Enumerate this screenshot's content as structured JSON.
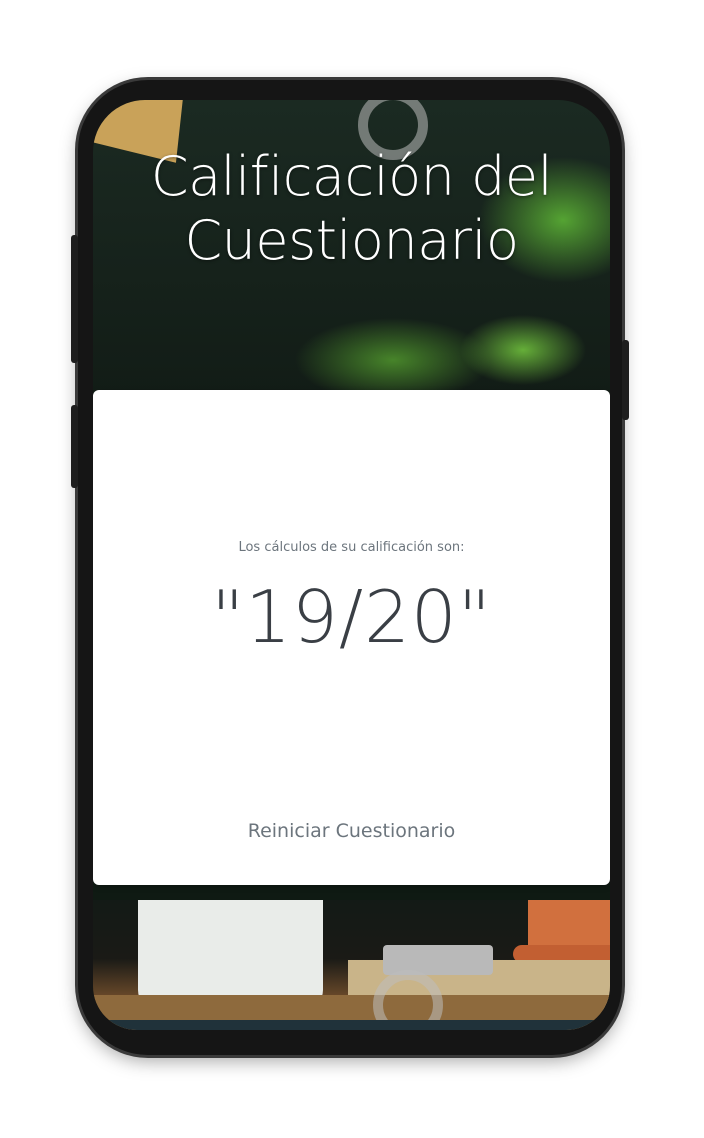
{
  "header": {
    "title": "Calificación del Cuestionario"
  },
  "result": {
    "caption": "Los cálculos de su calificación son:",
    "score": "\"19/20\""
  },
  "actions": {
    "restart_label": "Reiniciar Cuestionario"
  },
  "colors": {
    "card": "#ffffff",
    "caption": "#6c757d",
    "score": "#3a3f45",
    "title": "#ffffff"
  }
}
